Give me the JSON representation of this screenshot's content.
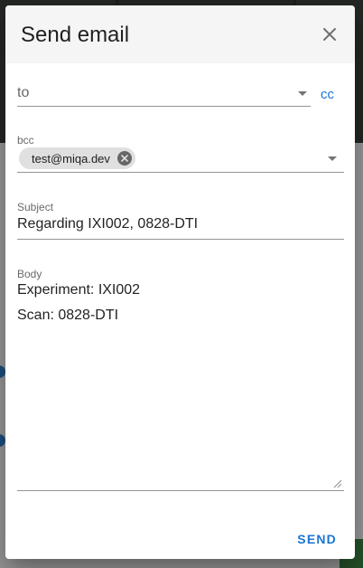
{
  "dialog": {
    "title": "Send email",
    "close_icon": "close-icon",
    "to": {
      "placeholder": "to"
    },
    "cc_label": "cc",
    "bcc": {
      "label": "bcc",
      "chips": [
        {
          "text": "test@miqa.dev"
        }
      ]
    },
    "subject": {
      "label": "Subject",
      "value": "Regarding IXI002, 0828-DTI"
    },
    "body": {
      "label": "Body",
      "lines": [
        "Experiment: IXI002",
        "Scan: 0828-DTI"
      ]
    },
    "send_label": "SEND"
  },
  "colors": {
    "accent": "#1976d2",
    "header_bg": "#f5f5f5",
    "chip_bg": "#e0e0e0"
  }
}
